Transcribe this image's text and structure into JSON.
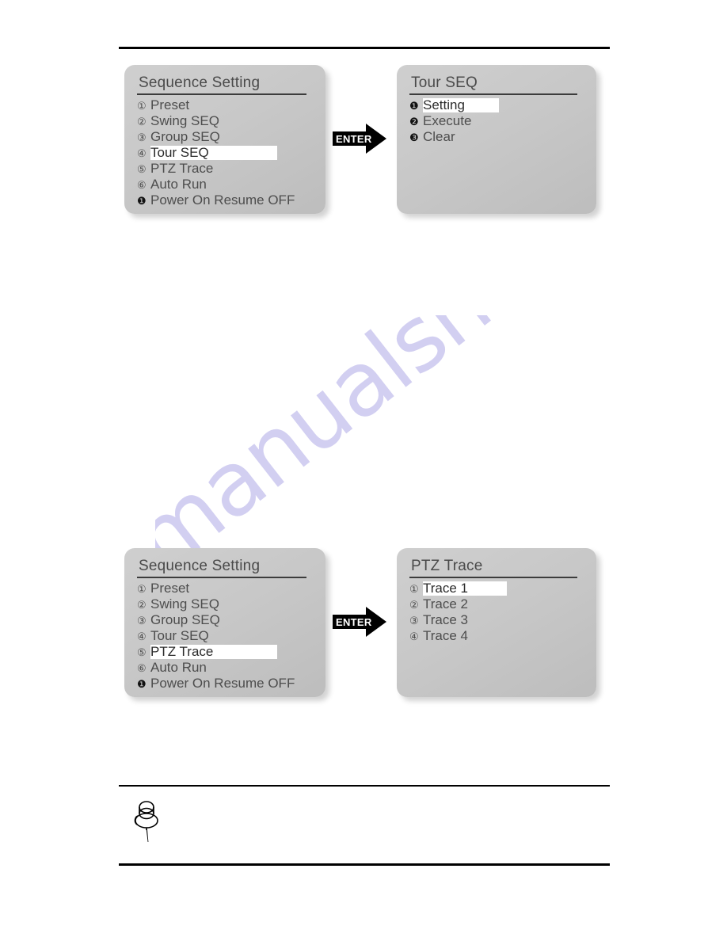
{
  "page": {
    "watermark_text": "manualshive.com",
    "watermark_color": "#d2cff1",
    "rule_color": "#000000"
  },
  "note": {
    "icon": "pushpin-icon"
  },
  "diagrams": [
    {
      "id": "diagram-tour-seq",
      "left_panel": {
        "title": "Sequence Setting",
        "items": [
          {
            "num": "①",
            "label": "Preset",
            "selected": false,
            "filled": false
          },
          {
            "num": "②",
            "label": "Swing SEQ",
            "selected": false,
            "filled": false
          },
          {
            "num": "③",
            "label": "Group SEQ",
            "selected": false,
            "filled": false
          },
          {
            "num": "④",
            "label": "Tour SEQ",
            "selected": true,
            "filled": false
          },
          {
            "num": "⑤",
            "label": "PTZ Trace",
            "selected": false,
            "filled": false
          },
          {
            "num": "⑥",
            "label": "Auto Run",
            "selected": false,
            "filled": false
          },
          {
            "num": "❶",
            "label": "Power On Resume OFF",
            "selected": false,
            "filled": true
          }
        ]
      },
      "connector": {
        "label": "ENTER"
      },
      "right_panel": {
        "title": "Tour SEQ",
        "items": [
          {
            "num": "❶",
            "label": "Setting",
            "selected": true,
            "filled": true
          },
          {
            "num": "❷",
            "label": "Execute",
            "selected": false,
            "filled": true
          },
          {
            "num": "❸",
            "label": "Clear",
            "selected": false,
            "filled": true
          }
        ]
      }
    },
    {
      "id": "diagram-ptz-trace",
      "left_panel": {
        "title": "Sequence Setting",
        "items": [
          {
            "num": "①",
            "label": "Preset",
            "selected": false,
            "filled": false
          },
          {
            "num": "②",
            "label": "Swing SEQ",
            "selected": false,
            "filled": false
          },
          {
            "num": "③",
            "label": "Group SEQ",
            "selected": false,
            "filled": false
          },
          {
            "num": "④",
            "label": "Tour SEQ",
            "selected": false,
            "filled": false
          },
          {
            "num": "⑤",
            "label": "PTZ Trace",
            "selected": true,
            "filled": false
          },
          {
            "num": "⑥",
            "label": "Auto Run",
            "selected": false,
            "filled": false
          },
          {
            "num": "❶",
            "label": "Power On Resume OFF",
            "selected": false,
            "filled": true
          }
        ]
      },
      "connector": {
        "label": "ENTER"
      },
      "right_panel": {
        "title": "PTZ Trace",
        "items": [
          {
            "num": "①",
            "label": "Trace 1",
            "selected": true,
            "filled": false
          },
          {
            "num": "②",
            "label": "Trace 2",
            "selected": false,
            "filled": false
          },
          {
            "num": "③",
            "label": "Trace 3",
            "selected": false,
            "filled": false
          },
          {
            "num": "④",
            "label": "Trace 4",
            "selected": false,
            "filled": false
          }
        ]
      }
    }
  ]
}
